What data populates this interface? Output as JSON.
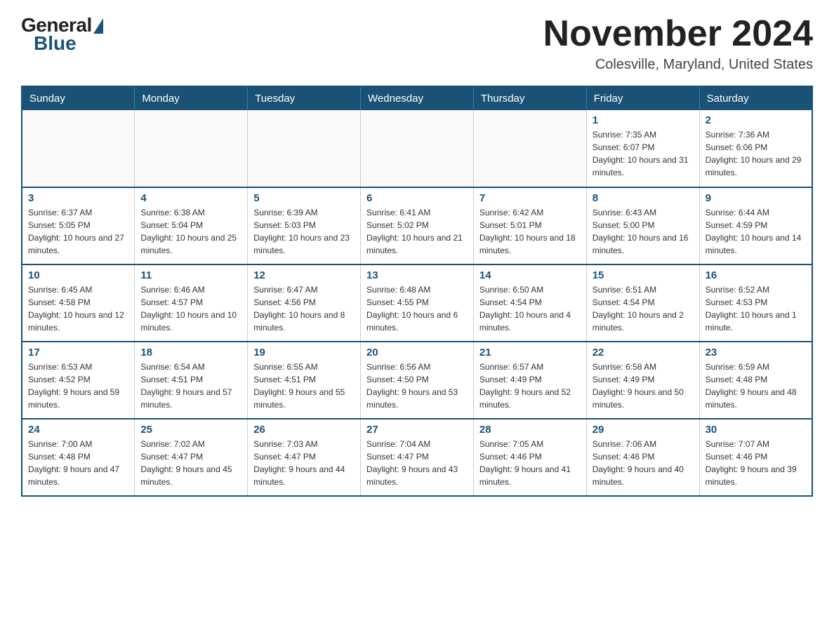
{
  "header": {
    "logo_general": "General",
    "logo_blue": "Blue",
    "month_title": "November 2024",
    "location": "Colesville, Maryland, United States"
  },
  "days_of_week": [
    "Sunday",
    "Monday",
    "Tuesday",
    "Wednesday",
    "Thursday",
    "Friday",
    "Saturday"
  ],
  "weeks": [
    [
      {
        "day": "",
        "info": ""
      },
      {
        "day": "",
        "info": ""
      },
      {
        "day": "",
        "info": ""
      },
      {
        "day": "",
        "info": ""
      },
      {
        "day": "",
        "info": ""
      },
      {
        "day": "1",
        "info": "Sunrise: 7:35 AM\nSunset: 6:07 PM\nDaylight: 10 hours and 31 minutes."
      },
      {
        "day": "2",
        "info": "Sunrise: 7:36 AM\nSunset: 6:06 PM\nDaylight: 10 hours and 29 minutes."
      }
    ],
    [
      {
        "day": "3",
        "info": "Sunrise: 6:37 AM\nSunset: 5:05 PM\nDaylight: 10 hours and 27 minutes."
      },
      {
        "day": "4",
        "info": "Sunrise: 6:38 AM\nSunset: 5:04 PM\nDaylight: 10 hours and 25 minutes."
      },
      {
        "day": "5",
        "info": "Sunrise: 6:39 AM\nSunset: 5:03 PM\nDaylight: 10 hours and 23 minutes."
      },
      {
        "day": "6",
        "info": "Sunrise: 6:41 AM\nSunset: 5:02 PM\nDaylight: 10 hours and 21 minutes."
      },
      {
        "day": "7",
        "info": "Sunrise: 6:42 AM\nSunset: 5:01 PM\nDaylight: 10 hours and 18 minutes."
      },
      {
        "day": "8",
        "info": "Sunrise: 6:43 AM\nSunset: 5:00 PM\nDaylight: 10 hours and 16 minutes."
      },
      {
        "day": "9",
        "info": "Sunrise: 6:44 AM\nSunset: 4:59 PM\nDaylight: 10 hours and 14 minutes."
      }
    ],
    [
      {
        "day": "10",
        "info": "Sunrise: 6:45 AM\nSunset: 4:58 PM\nDaylight: 10 hours and 12 minutes."
      },
      {
        "day": "11",
        "info": "Sunrise: 6:46 AM\nSunset: 4:57 PM\nDaylight: 10 hours and 10 minutes."
      },
      {
        "day": "12",
        "info": "Sunrise: 6:47 AM\nSunset: 4:56 PM\nDaylight: 10 hours and 8 minutes."
      },
      {
        "day": "13",
        "info": "Sunrise: 6:48 AM\nSunset: 4:55 PM\nDaylight: 10 hours and 6 minutes."
      },
      {
        "day": "14",
        "info": "Sunrise: 6:50 AM\nSunset: 4:54 PM\nDaylight: 10 hours and 4 minutes."
      },
      {
        "day": "15",
        "info": "Sunrise: 6:51 AM\nSunset: 4:54 PM\nDaylight: 10 hours and 2 minutes."
      },
      {
        "day": "16",
        "info": "Sunrise: 6:52 AM\nSunset: 4:53 PM\nDaylight: 10 hours and 1 minute."
      }
    ],
    [
      {
        "day": "17",
        "info": "Sunrise: 6:53 AM\nSunset: 4:52 PM\nDaylight: 9 hours and 59 minutes."
      },
      {
        "day": "18",
        "info": "Sunrise: 6:54 AM\nSunset: 4:51 PM\nDaylight: 9 hours and 57 minutes."
      },
      {
        "day": "19",
        "info": "Sunrise: 6:55 AM\nSunset: 4:51 PM\nDaylight: 9 hours and 55 minutes."
      },
      {
        "day": "20",
        "info": "Sunrise: 6:56 AM\nSunset: 4:50 PM\nDaylight: 9 hours and 53 minutes."
      },
      {
        "day": "21",
        "info": "Sunrise: 6:57 AM\nSunset: 4:49 PM\nDaylight: 9 hours and 52 minutes."
      },
      {
        "day": "22",
        "info": "Sunrise: 6:58 AM\nSunset: 4:49 PM\nDaylight: 9 hours and 50 minutes."
      },
      {
        "day": "23",
        "info": "Sunrise: 6:59 AM\nSunset: 4:48 PM\nDaylight: 9 hours and 48 minutes."
      }
    ],
    [
      {
        "day": "24",
        "info": "Sunrise: 7:00 AM\nSunset: 4:48 PM\nDaylight: 9 hours and 47 minutes."
      },
      {
        "day": "25",
        "info": "Sunrise: 7:02 AM\nSunset: 4:47 PM\nDaylight: 9 hours and 45 minutes."
      },
      {
        "day": "26",
        "info": "Sunrise: 7:03 AM\nSunset: 4:47 PM\nDaylight: 9 hours and 44 minutes."
      },
      {
        "day": "27",
        "info": "Sunrise: 7:04 AM\nSunset: 4:47 PM\nDaylight: 9 hours and 43 minutes."
      },
      {
        "day": "28",
        "info": "Sunrise: 7:05 AM\nSunset: 4:46 PM\nDaylight: 9 hours and 41 minutes."
      },
      {
        "day": "29",
        "info": "Sunrise: 7:06 AM\nSunset: 4:46 PM\nDaylight: 9 hours and 40 minutes."
      },
      {
        "day": "30",
        "info": "Sunrise: 7:07 AM\nSunset: 4:46 PM\nDaylight: 9 hours and 39 minutes."
      }
    ]
  ]
}
